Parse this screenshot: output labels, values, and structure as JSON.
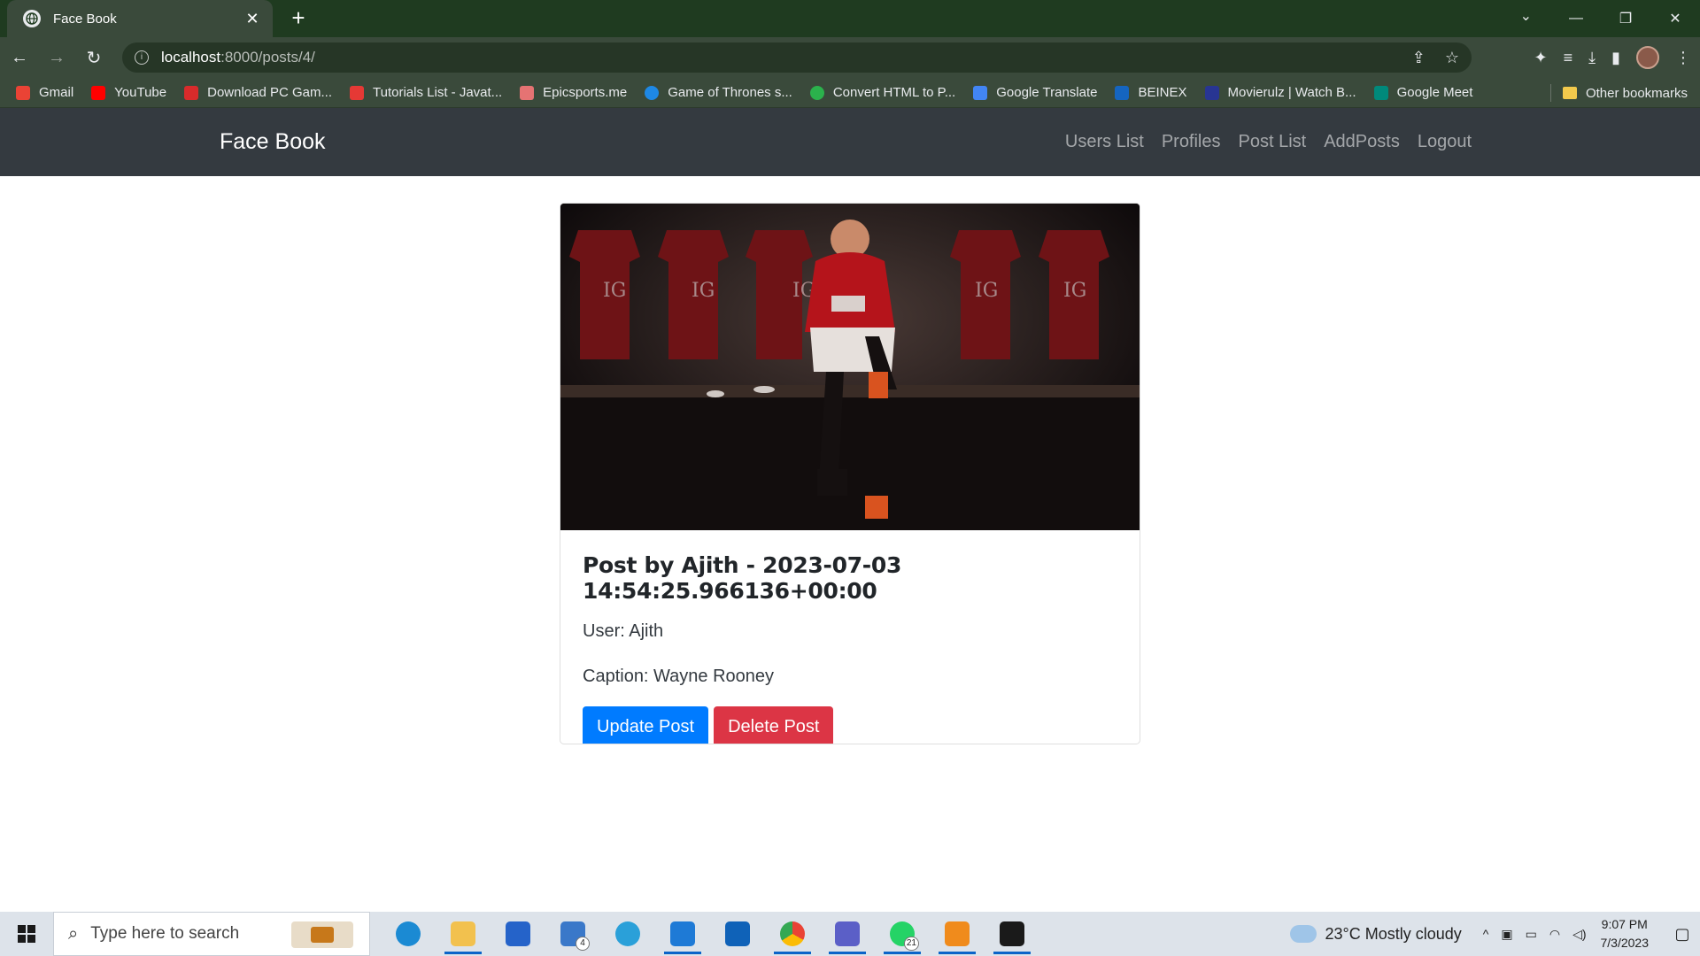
{
  "browser": {
    "tab_title": "Face Book",
    "url_host": "localhost",
    "url_path": ":8000/posts/4/",
    "bookmarks": [
      {
        "label": "Gmail",
        "color": "#ea4335"
      },
      {
        "label": "YouTube",
        "color": "#ff0000"
      },
      {
        "label": "Download PC Gam...",
        "color": "#d92b2b"
      },
      {
        "label": "Tutorials List - Javat...",
        "color": "#e53935"
      },
      {
        "label": "Epicsports.me",
        "color": "#e57373"
      },
      {
        "label": "Game of Thrones s...",
        "color": "#1e88e5"
      },
      {
        "label": "Convert HTML to P...",
        "color": "#2bb24c"
      },
      {
        "label": "Google Translate",
        "color": "#4285f4"
      },
      {
        "label": "BEINEX",
        "color": "#1565c0"
      },
      {
        "label": "Movierulz | Watch B...",
        "color": "#283593"
      },
      {
        "label": "Google Meet",
        "color": "#00897b"
      }
    ],
    "other_bookmarks": "Other bookmarks"
  },
  "site": {
    "brand": "Face Book",
    "nav": [
      "Users List",
      "Profiles",
      "Post List",
      "AddPosts",
      "Logout"
    ]
  },
  "post": {
    "title": "Post by Ajith - 2023-07-03 14:54:25.966136+00:00",
    "user_line": "User: Ajith",
    "caption_line": "Caption: Wayne Rooney",
    "update_label": "Update Post",
    "delete_label": "Delete Post"
  },
  "taskbar": {
    "search_placeholder": "Type here to search",
    "mail_badge": "4",
    "whatsapp_badge": "21",
    "weather": "23°C  Mostly cloudy",
    "time": "9:07 PM",
    "date": "7/3/2023"
  }
}
